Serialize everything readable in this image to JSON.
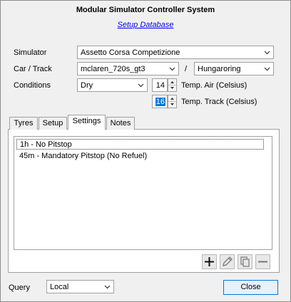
{
  "window": {
    "title": "Modular Simulator Controller System",
    "link": "Setup Database"
  },
  "form": {
    "simulator_label": "Simulator",
    "simulator_value": "Assetto Corsa Competizione",
    "car_track_label": "Car / Track",
    "car_value": "mclaren_720s_gt3",
    "separator": "/",
    "track_value": "Hungaroring",
    "conditions_label": "Conditions",
    "weather_value": "Dry",
    "temp_air_value": "14",
    "temp_air_label": "Temp. Air (Celsius)",
    "temp_track_value": "16",
    "temp_track_label": "Temp. Track (Celsius)"
  },
  "tabs": [
    {
      "label": "Tyres"
    },
    {
      "label": "Setup"
    },
    {
      "label": "Settings"
    },
    {
      "label": "Notes"
    }
  ],
  "settings_list": [
    "1h - No Pitstop",
    "45m - Mandatory Pitstop (No Refuel)"
  ],
  "toolbar_icons": [
    "plus-icon",
    "pencil-icon",
    "copy-icon",
    "minus-icon"
  ],
  "footer": {
    "query_label": "Query",
    "query_value": "Local",
    "close_label": "Close"
  }
}
